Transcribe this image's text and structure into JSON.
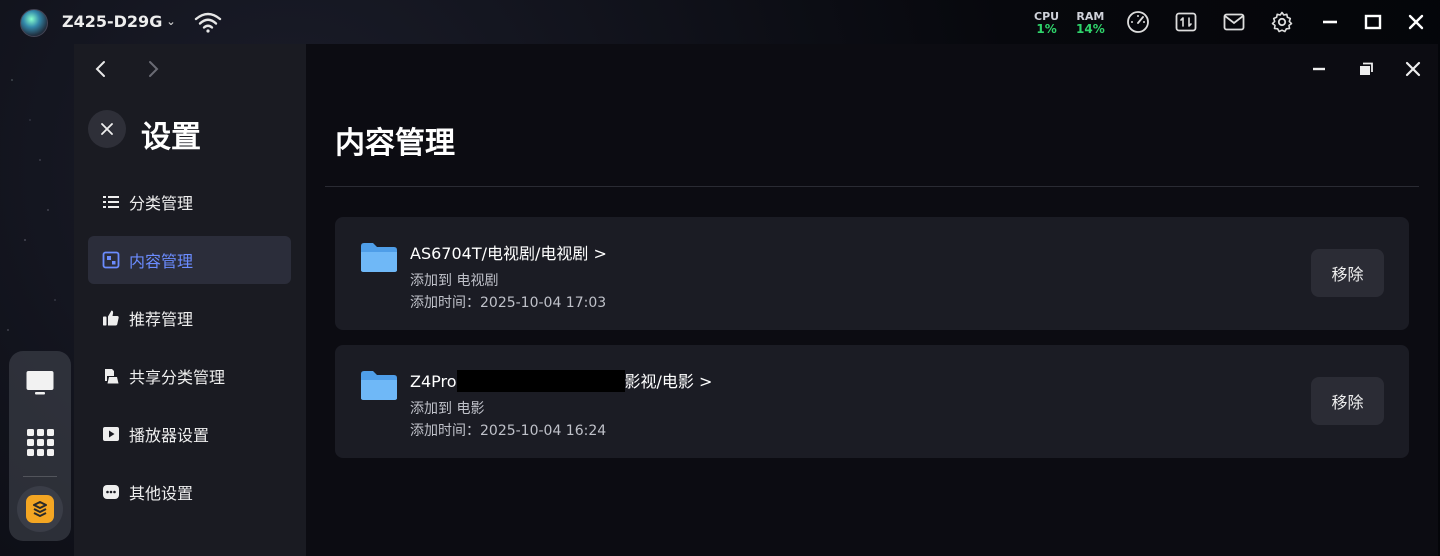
{
  "topbar": {
    "device_name": "Z425-D29G",
    "cpu_label": "CPU",
    "cpu_value": "1%",
    "ram_label": "RAM",
    "ram_value": "14%"
  },
  "nav": {
    "back_icon": "chevron-left-icon",
    "forward_icon": "chevron-right-icon"
  },
  "sidebar": {
    "title": "设置",
    "items": [
      {
        "label": "分类管理",
        "icon": "list-icon"
      },
      {
        "label": "内容管理",
        "icon": "content-icon",
        "active": true
      },
      {
        "label": "推荐管理",
        "icon": "thumbs-up-icon"
      },
      {
        "label": "共享分类管理",
        "icon": "share-icon"
      },
      {
        "label": "播放器设置",
        "icon": "play-icon"
      },
      {
        "label": "其他设置",
        "icon": "more-icon"
      }
    ]
  },
  "main": {
    "title": "内容管理",
    "entries": [
      {
        "path": "AS6704T/电视剧/电视剧 >",
        "added_to": "添加到 电视剧",
        "added_time": "添加时间：2025-10-04 17:03",
        "remove_label": "移除"
      },
      {
        "path_prefix": "Z4Pro",
        "path_suffix": "影视/电影 >",
        "added_to": "添加到 电影",
        "added_time": "添加时间：2025-10-04 16:24",
        "remove_label": "移除"
      }
    ]
  },
  "colors": {
    "accent": "#6b8cff",
    "stat_green": "#2fd46b",
    "folder_blue": "#5aa9f5",
    "dock_app": "#f4a623"
  }
}
